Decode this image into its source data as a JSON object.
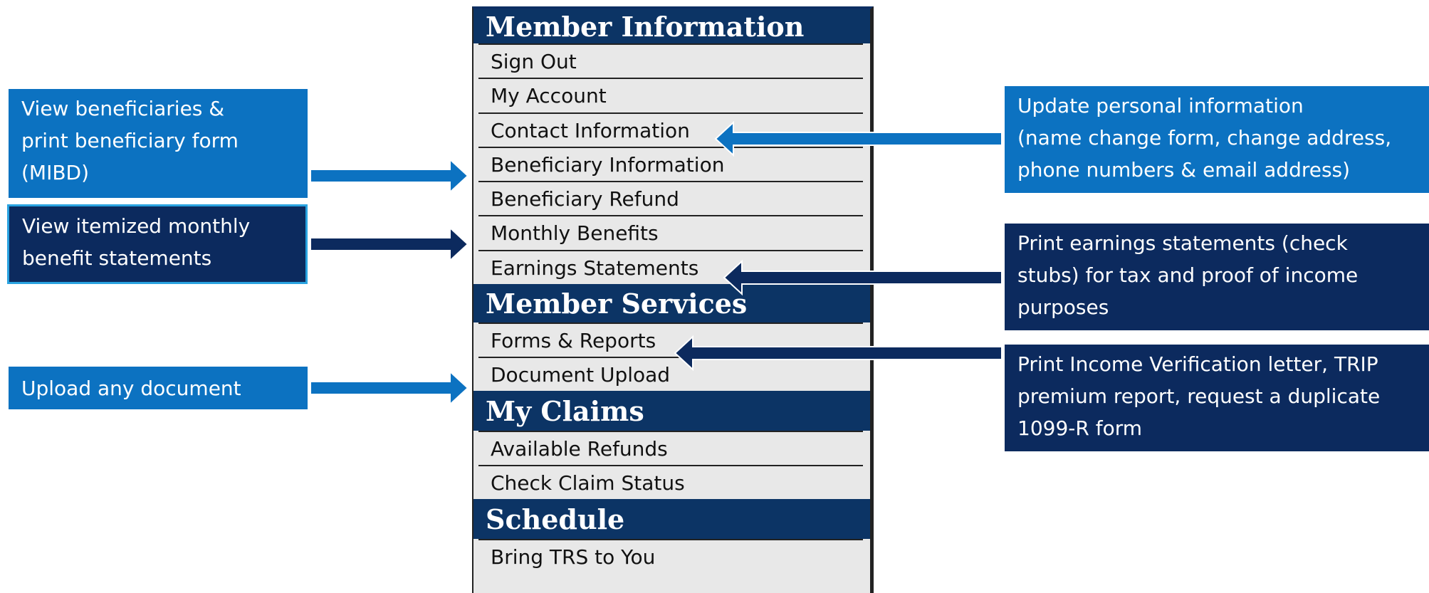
{
  "menu": {
    "sections": [
      {
        "title": "Member Information",
        "items": [
          "Sign Out",
          "My Account",
          "Contact Information",
          "Beneficiary Information",
          "Beneficiary Refund",
          "Monthly Benefits",
          "Earnings Statements"
        ]
      },
      {
        "title": "Member Services",
        "items": [
          "Forms & Reports",
          "Document Upload"
        ]
      },
      {
        "title": "My Claims",
        "items": [
          "Available Refunds",
          "Check Claim Status"
        ]
      },
      {
        "title": "Schedule",
        "items": [
          "Bring TRS to You"
        ]
      }
    ]
  },
  "callouts": {
    "beneficiary": "View beneficiaries &\nprint beneficiary form\n(MIBD)",
    "monthly": "View itemized monthly\nbenefit statements",
    "upload": "Upload any document",
    "contact": "Update personal information\n(name change form, change address,\nphone numbers & email address)",
    "earnings": "Print earnings statements (check\nstubs) for tax and proof of income\npurposes",
    "forms": "Print Income Verification letter, TRIP\npremium report, request a duplicate\n1099-R form"
  },
  "colors": {
    "callout_light": "#0c72c1",
    "callout_dark": "#0c2a5e",
    "menu_header": "#0c3465",
    "menu_item_bg": "#e8e8e8"
  }
}
